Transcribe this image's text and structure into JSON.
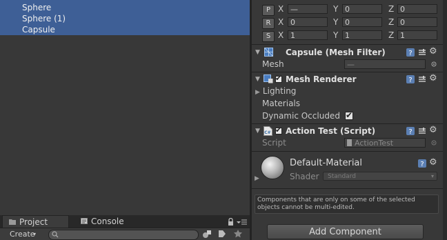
{
  "hierarchy": {
    "items": [
      {
        "label": "Sphere"
      },
      {
        "label": "Sphere (1)"
      },
      {
        "label": "Capsule"
      }
    ]
  },
  "bottom_panel": {
    "tabs": [
      {
        "label": "Project"
      },
      {
        "label": "Console"
      }
    ],
    "create_label": "Create",
    "search_placeholder": ""
  },
  "transform": {
    "rows": [
      {
        "button": "P",
        "x": "—",
        "y": "0",
        "z": "0"
      },
      {
        "button": "R",
        "x": "0",
        "y": "0",
        "z": "0"
      },
      {
        "button": "S",
        "x": "1",
        "y": "1",
        "z": "1"
      }
    ],
    "axis_x": "X",
    "axis_y": "Y",
    "axis_z": "Z"
  },
  "mesh_filter": {
    "title": "Capsule (Mesh Filter)",
    "mesh_label": "Mesh",
    "mesh_value": "—"
  },
  "mesh_renderer": {
    "title": "Mesh Renderer",
    "lighting_label": "Lighting",
    "materials_label": "Materials",
    "dynamic_occluded_label": "Dynamic Occluded",
    "dynamic_occluded": true
  },
  "action_test": {
    "title": "Action Test (Script)",
    "script_label": "Script",
    "script_value": "ActionTest"
  },
  "material": {
    "name": "Default-Material",
    "shader_label": "Shader",
    "shader_value": "Standard"
  },
  "notice": "Components that are only on some of the selected objects cannot be multi-edited.",
  "add_component_label": "Add Component"
}
